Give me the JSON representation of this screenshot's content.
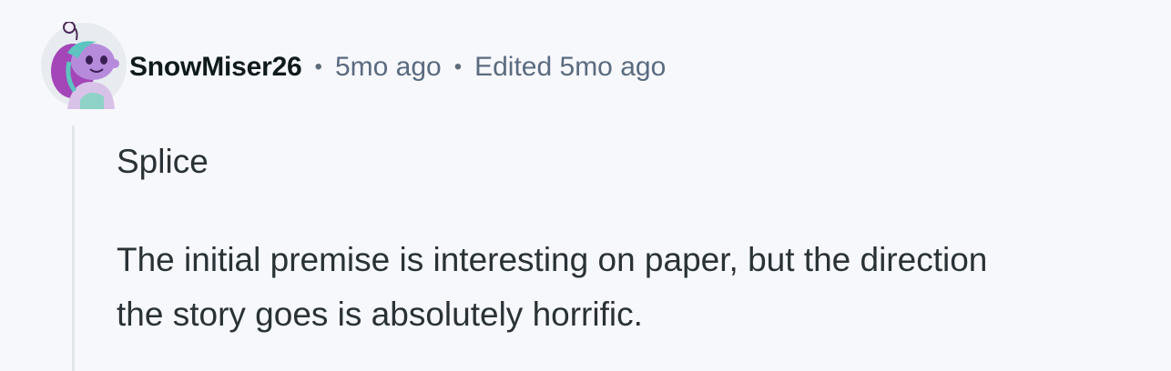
{
  "comment": {
    "author": "SnowMiser26",
    "separator": "•",
    "posted_time": "5mo ago",
    "edited_text": "Edited 5mo ago",
    "paragraphs": [
      "Splice",
      "The initial premise is interesting on paper, but the direction the story goes is absolutely horrific."
    ],
    "avatar_icon": "snoo-avatar-icon"
  }
}
